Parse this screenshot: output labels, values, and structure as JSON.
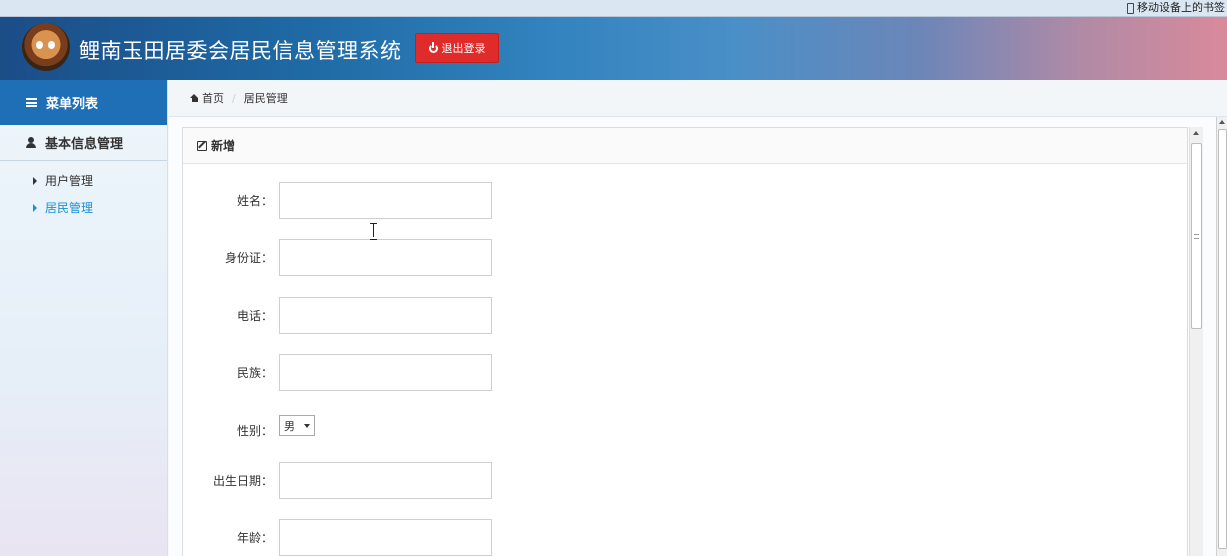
{
  "browser": {
    "mobile_bookmarks": "移动设备上的书签",
    "mobile_bookmarks_icon": "phone-icon"
  },
  "header": {
    "title": "鲤南玉田居委会居民信息管理系统",
    "logout_label": "退出登录",
    "logout_icon": "power-icon",
    "logout_color": "#e02b2b",
    "brand_color": "#1e6fb5"
  },
  "sidebar": {
    "title": "菜单列表",
    "title_icon": "list-icon",
    "group": {
      "label": "基本信息管理",
      "icon": "user-icon"
    },
    "items": [
      {
        "label": "用户管理",
        "active": false
      },
      {
        "label": "居民管理",
        "active": true
      }
    ]
  },
  "breadcrumb": {
    "home": "首页",
    "current": "居民管理"
  },
  "panel": {
    "title": "新增",
    "title_icon": "edit-icon"
  },
  "form": {
    "fields": [
      {
        "label": "姓名：",
        "value": ""
      },
      {
        "label": "身份证：",
        "value": ""
      },
      {
        "label": "电话：",
        "value": ""
      },
      {
        "label": "民族：",
        "value": ""
      },
      {
        "label": "性别：",
        "value": "男"
      },
      {
        "label": "出生日期：",
        "value": ""
      },
      {
        "label": "年龄：",
        "value": ""
      }
    ]
  }
}
